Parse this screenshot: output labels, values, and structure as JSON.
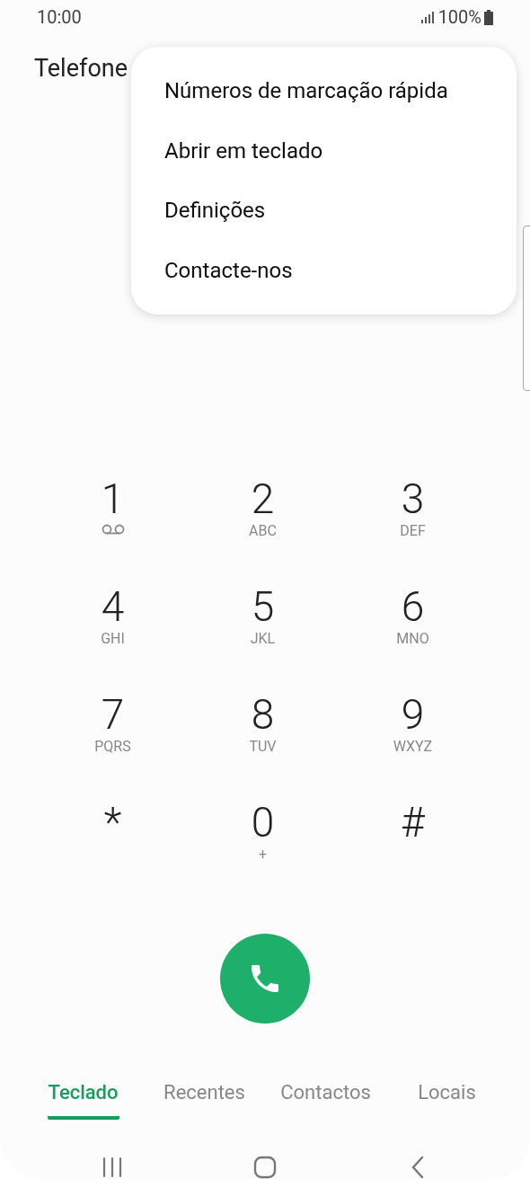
{
  "status_bar": {
    "time": "10:00",
    "battery": "100%"
  },
  "header": {
    "title": "Telefone"
  },
  "menu": {
    "items": [
      {
        "label": "Números de marcação rápida"
      },
      {
        "label": "Abrir em teclado"
      },
      {
        "label": "Definições"
      },
      {
        "label": "Contacte-nos"
      }
    ]
  },
  "keypad": {
    "keys": [
      {
        "digit": "1",
        "kind": "voicemail"
      },
      {
        "digit": "2",
        "kind": "letters",
        "letters": "ABC"
      },
      {
        "digit": "3",
        "kind": "letters",
        "letters": "DEF"
      },
      {
        "digit": "4",
        "kind": "letters",
        "letters": "GHI"
      },
      {
        "digit": "5",
        "kind": "letters",
        "letters": "JKL"
      },
      {
        "digit": "6",
        "kind": "letters",
        "letters": "MNO"
      },
      {
        "digit": "7",
        "kind": "letters",
        "letters": "PQRS"
      },
      {
        "digit": "8",
        "kind": "letters",
        "letters": "TUV"
      },
      {
        "digit": "9",
        "kind": "letters",
        "letters": "WXYZ"
      },
      {
        "digit": "*",
        "kind": "plain"
      },
      {
        "digit": "0",
        "kind": "letters",
        "letters": "+"
      },
      {
        "digit": "#",
        "kind": "plain"
      }
    ]
  },
  "tabs": [
    {
      "label": "Teclado",
      "selected": true
    },
    {
      "label": "Recentes",
      "selected": false
    },
    {
      "label": "Contactos",
      "selected": false
    },
    {
      "label": "Locais",
      "selected": false
    }
  ]
}
